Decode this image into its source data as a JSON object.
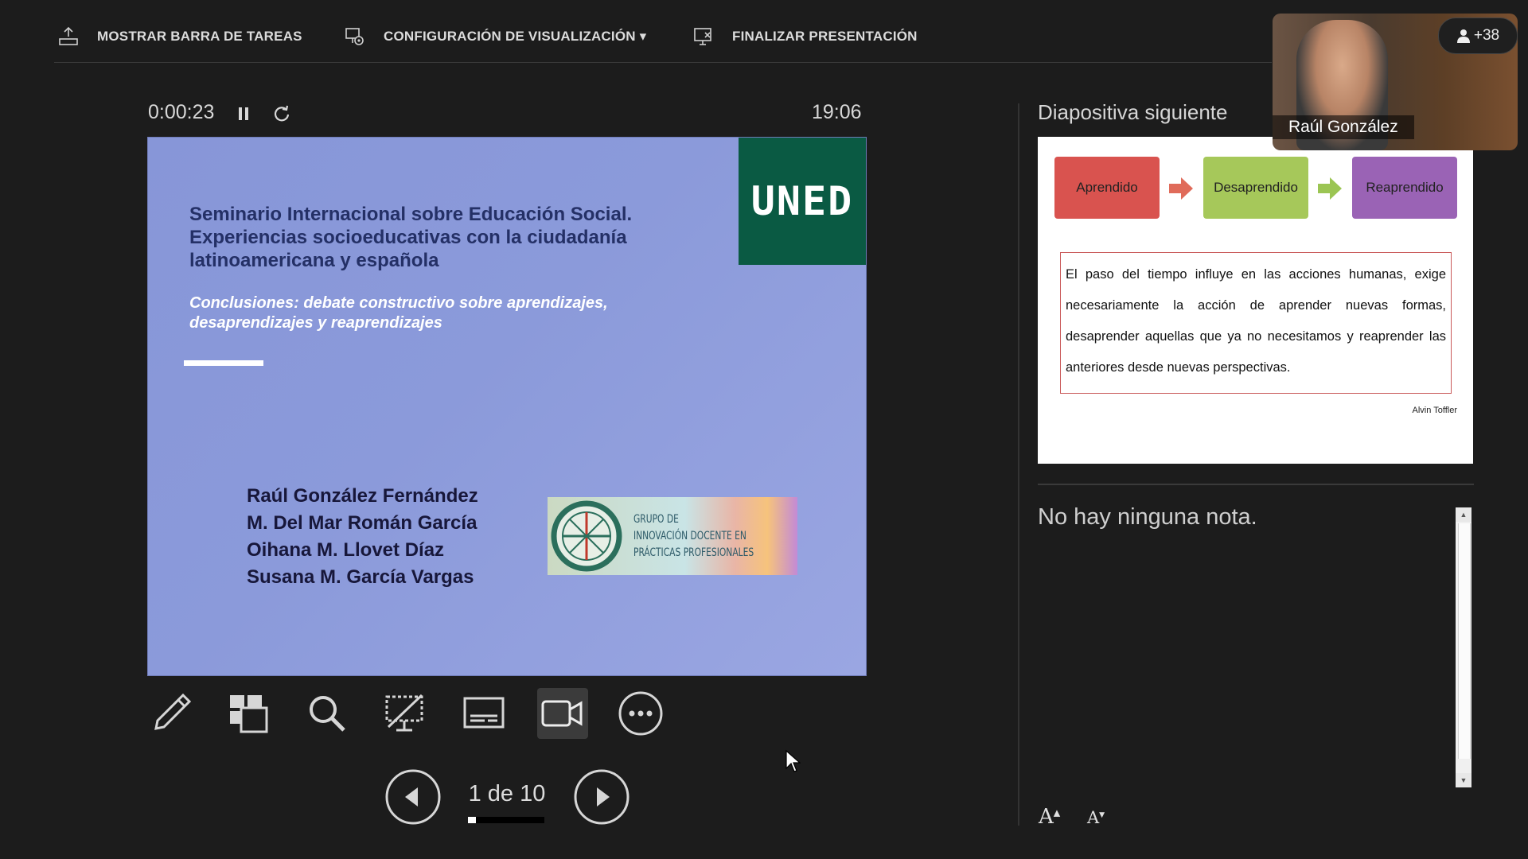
{
  "toolbar": {
    "taskbar_label": "MOSTRAR BARRA DE TAREAS",
    "display_label": "CONFIGURACIÓN DE VISUALIZACIÓN ▾",
    "end_label": "FINALIZAR PRESENTACIÓN"
  },
  "timer": {
    "elapsed": "0:00:23",
    "clock": "19:06"
  },
  "current_slide": {
    "logo_text": "UNED",
    "title": "Seminario Internacional sobre Educación Social. Experiencias socioeducativas con la ciudadanía latinoamericana y española",
    "subtitle": "Conclusiones: debate constructivo sobre aprendizajes, desaprendizajes y reaprendizajes",
    "authors": [
      "Raúl González Fernández",
      "M. Del Mar Román García",
      "Oihana M. Llovet Díaz",
      "Susana M. García Vargas"
    ],
    "group_logo_text": "GRUPO DE\nINNOVACIÓN DOCENTE EN\nPRÁCTICAS PROFESIONALES"
  },
  "navigation": {
    "pager": "1 de 10",
    "progress": 0.1
  },
  "next_slide": {
    "heading": "Diapositiva siguiente",
    "boxes": [
      {
        "label": "Aprendido",
        "color": "#d9534f"
      },
      {
        "label": "Desaprendido",
        "color": "#a6c85a"
      },
      {
        "label": "Reaprendido",
        "color": "#9a63b5"
      }
    ],
    "arrow_colors": [
      "#e06b5a",
      "#9bc553"
    ],
    "quote": "El paso del tiempo influye en las acciones humanas, exige necesariamente la acción de aprender nuevas formas, desaprender aquellas que ya no necesitamos y reaprender las anteriores desde nuevas perspectivas.",
    "quote_author": "Alvin Toffler"
  },
  "notes": {
    "text": "No hay ninguna nota."
  },
  "font_controls": {
    "increase": "A",
    "decrease": "A"
  },
  "camera": {
    "name": "Raúl González",
    "participants_badge": "+38"
  }
}
